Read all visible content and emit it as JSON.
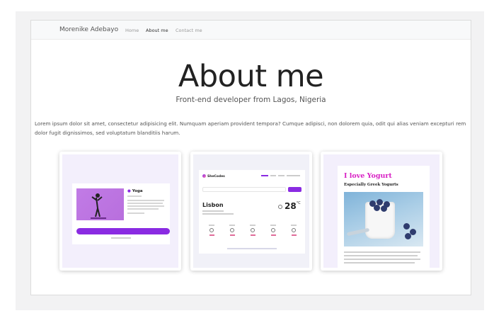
{
  "navbar": {
    "brand": "Morenike Adebayo",
    "links": [
      {
        "label": "Home",
        "active": false
      },
      {
        "label": "About me",
        "active": true
      },
      {
        "label": "Contact me",
        "active": false
      }
    ]
  },
  "hero": {
    "title": "About me",
    "subtitle": "Front-end developer from Lagos, Nigeria"
  },
  "intro": {
    "text": "Lorem ipsum dolor sit amet, consectetur adipisicing elit. Numquam aperiam provident tempora? Cumque adipisci, non dolorem quia, odit qui alias veniam excepturi rem dolor fugit dignissimos, sed voluptatum blanditiis harum."
  },
  "projects": {
    "yoga": {
      "title": "Yoga"
    },
    "weather": {
      "logo": "SheCodes",
      "city": "Lisbon",
      "temperature": "28",
      "unit": "°C"
    },
    "yogurt": {
      "title": "I love Yogurt",
      "subtitle": "Especially Greek Yogurts"
    }
  },
  "colors": {
    "accent": "#8a2be2",
    "yogurt_title": "#d81fc4",
    "navbar_bg": "#f8f9fa"
  }
}
